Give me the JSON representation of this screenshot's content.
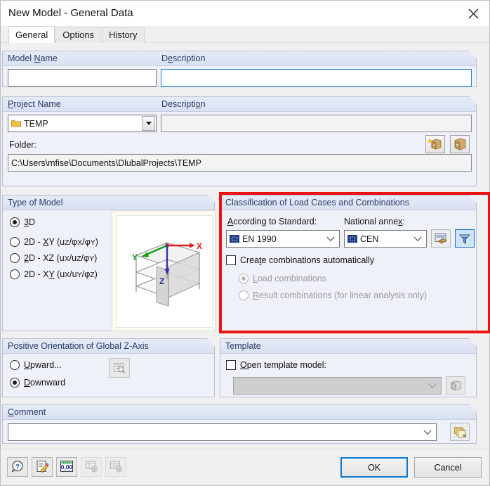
{
  "window": {
    "title": "New Model - General Data",
    "close_icon": "close-icon"
  },
  "tabs": [
    {
      "label": "General",
      "active": true
    },
    {
      "label": "Options",
      "active": false
    },
    {
      "label": "History",
      "active": false
    }
  ],
  "model_name_group": {
    "name_header": "Model Name",
    "name_value": "",
    "description_header": "Description",
    "description_value": ""
  },
  "project_group": {
    "name_header": "Project Name",
    "project_value": "TEMP",
    "project_icon": "folder-icon",
    "description_header": "Description",
    "description_value": "",
    "new_project_button_icon": "new-project-cabinet-icon",
    "browse_project_button_icon": "project-cabinet-icon",
    "folder_label": "Folder:",
    "folder_value": "C:\\Users\\mfise\\Documents\\DlubalProjects\\TEMP"
  },
  "type_of_model": {
    "title": "Type of Model",
    "options": [
      {
        "label": "3D",
        "underline_index": 0,
        "selected": true
      },
      {
        "label": "2D - XY (uz/φx/φy)",
        "selected": false
      },
      {
        "label": "2D - XZ (ux/uz/φy)",
        "selected": false
      },
      {
        "label": "2D - XY (ux/uy/φz)",
        "selected": false
      }
    ],
    "preview_axes": {
      "x": "X",
      "y": "Y",
      "z": "Z"
    }
  },
  "classification": {
    "title": "Classification of Load Cases and Combinations",
    "standard_label": "According to Standard:",
    "standard_value": "EN 1990",
    "standard_icon": "eu-flag-icon",
    "annex_label": "National annex:",
    "annex_value": "CEN",
    "annex_icon": "eu-flag-icon",
    "settings_button_icon": "standard-settings-icon",
    "filter_button_icon": "filter-funnel-icon",
    "auto_combinations": {
      "label": "Create combinations automatically",
      "checked": false
    },
    "sub_options": [
      {
        "label": "Load combinations",
        "selected": true,
        "disabled": true
      },
      {
        "label": "Result combinations (for linear analysis only)",
        "selected": false,
        "disabled": true
      }
    ],
    "highlight_color": "#ee1111"
  },
  "z_axis": {
    "title": "Positive Orientation of Global Z-Axis",
    "options": [
      {
        "label": "Upward...",
        "selected": false
      },
      {
        "label": "Downward",
        "selected": true
      }
    ],
    "preview_button_icon": "preview-document-icon"
  },
  "template": {
    "title": "Template",
    "open_template_label": "Open template model:",
    "open_template_checked": false,
    "template_value": "",
    "browse_button_icon": "template-box-icon"
  },
  "comment": {
    "title": "Comment",
    "value": "",
    "pick_button_icon": "comment-stack-icon"
  },
  "bottom_toolbar": [
    {
      "name": "help-button",
      "icon": "help-question-icon",
      "disabled": false
    },
    {
      "name": "edit-button",
      "icon": "edit-pencil-icon",
      "disabled": false
    },
    {
      "name": "units-button",
      "icon": "units-0-00-icon",
      "disabled": false
    },
    {
      "name": "export-excel-button",
      "icon": "export-table-icon",
      "disabled": true
    },
    {
      "name": "import-button",
      "icon": "import-table-icon",
      "disabled": true
    }
  ],
  "buttons": {
    "ok": "OK",
    "cancel": "Cancel"
  },
  "colors": {
    "accent_blue": "#1a7fd4",
    "group_header_text": "#2b3c66",
    "group_bg": "#eef1f8",
    "highlight_red": "#ee1111",
    "axis_x": "#e01b1b",
    "axis_y": "#11a011",
    "axis_z": "#3b2ea8"
  }
}
